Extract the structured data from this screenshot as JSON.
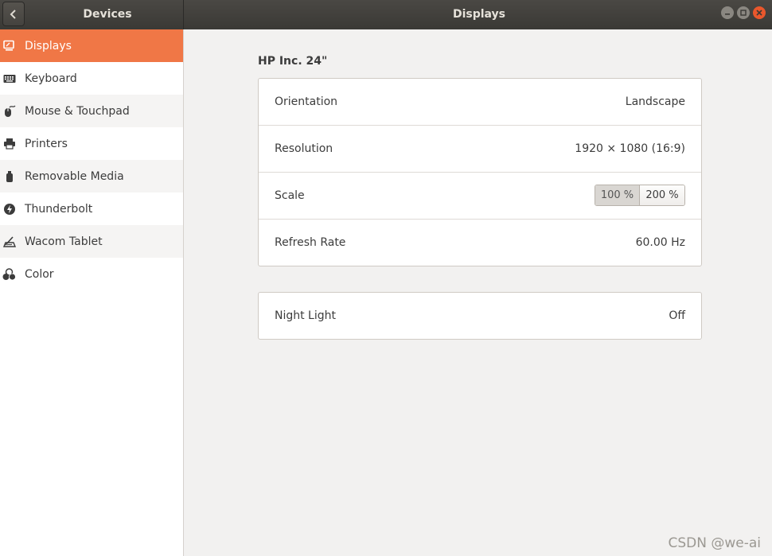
{
  "window": {
    "left_title": "Devices",
    "title": "Displays",
    "back_icon": "chevron-left-icon",
    "controls": [
      "minimize",
      "maximize",
      "close"
    ]
  },
  "sidebar": {
    "items": [
      {
        "label": "Displays",
        "icon": "display-icon",
        "active": true
      },
      {
        "label": "Keyboard",
        "icon": "keyboard-icon"
      },
      {
        "label": "Mouse & Touchpad",
        "icon": "mouse-icon"
      },
      {
        "label": "Printers",
        "icon": "printer-icon"
      },
      {
        "label": "Removable Media",
        "icon": "removable-media-icon"
      },
      {
        "label": "Thunderbolt",
        "icon": "thunderbolt-icon"
      },
      {
        "label": "Wacom Tablet",
        "icon": "tablet-icon"
      },
      {
        "label": "Color",
        "icon": "color-icon"
      }
    ]
  },
  "display": {
    "monitor_name": "HP Inc. 24\"",
    "orientation": {
      "label": "Orientation",
      "value": "Landscape"
    },
    "resolution": {
      "label": "Resolution",
      "value": "1920 × 1080 (16:9)"
    },
    "scale": {
      "label": "Scale",
      "options": [
        "100 %",
        "200 %"
      ],
      "selected": "100 %"
    },
    "refresh_rate": {
      "label": "Refresh Rate",
      "value": "60.00 Hz"
    },
    "night_light": {
      "label": "Night Light",
      "value": "Off"
    }
  },
  "watermark": "CSDN @we-ai",
  "colors": {
    "accent": "#f07746",
    "titlebar": "#3f3e3a",
    "close": "#e9572c"
  }
}
